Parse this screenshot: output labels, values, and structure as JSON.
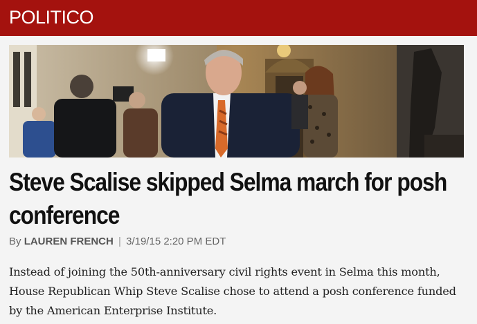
{
  "header": {
    "logo_text": "POLITICO",
    "brand_color": "#a4120e"
  },
  "article": {
    "image_alt": "Steve Scalise walking through a Capitol hallway with photographers and staff",
    "headline": "Steve Scalise skipped Selma march for posh conference",
    "byline": {
      "prefix": "By",
      "author": "LAUREN FRENCH",
      "separator": "|",
      "timestamp": "3/19/15 2:20 PM EDT"
    },
    "summary": "Instead of joining the 50th-anniversary civil rights event in Selma this month, House Republican Whip Steve Scalise chose to attend a posh conference funded by the American Enterprise Institute."
  }
}
